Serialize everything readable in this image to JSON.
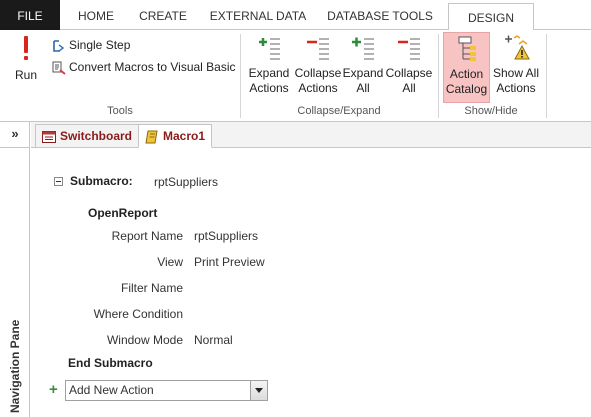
{
  "ribbon_tabs": [
    "FILE",
    "HOME",
    "CREATE",
    "EXTERNAL DATA",
    "DATABASE TOOLS",
    "DESIGN"
  ],
  "tools": {
    "run_label": "Run",
    "single_step_label": "Single Step",
    "convert_label": "Convert Macros to Visual Basic",
    "group_label": "Tools"
  },
  "collapse_expand": {
    "expand_actions": [
      "Expand",
      "Actions"
    ],
    "collapse_actions": [
      "Collapse",
      "Actions"
    ],
    "expand_all": [
      "Expand",
      "All"
    ],
    "collapse_all": [
      "Collapse",
      "All"
    ],
    "group_label": "Collapse/Expand"
  },
  "show_hide": {
    "action_catalog": [
      "Action",
      "Catalog"
    ],
    "show_all_actions": [
      "Show All",
      "Actions"
    ],
    "group_label": "Show/Hide"
  },
  "nav": {
    "toggle_glyph": "»",
    "label": "Navigation Pane"
  },
  "doc_tabs": [
    {
      "label": "Switchboard",
      "active": false
    },
    {
      "label": "Macro1",
      "active": true
    }
  ],
  "macro": {
    "submacro_keyword": "Submacro:",
    "submacro_name": "rptSuppliers",
    "action_name": "OpenReport",
    "arguments": [
      {
        "name": "Report Name",
        "value": "rptSuppliers"
      },
      {
        "name": "View",
        "value": "Print Preview"
      },
      {
        "name": "Filter Name",
        "value": ""
      },
      {
        "name": "Where Condition",
        "value": ""
      },
      {
        "name": "Window Mode",
        "value": "Normal"
      }
    ],
    "end_label": "End Submacro",
    "add_action_value": "Add New Action"
  },
  "colors": {
    "active_button_bg": "#f7c3c3",
    "file_tab_bg": "#1a1a1a",
    "doc_tab_text": "#8b1a1a"
  }
}
